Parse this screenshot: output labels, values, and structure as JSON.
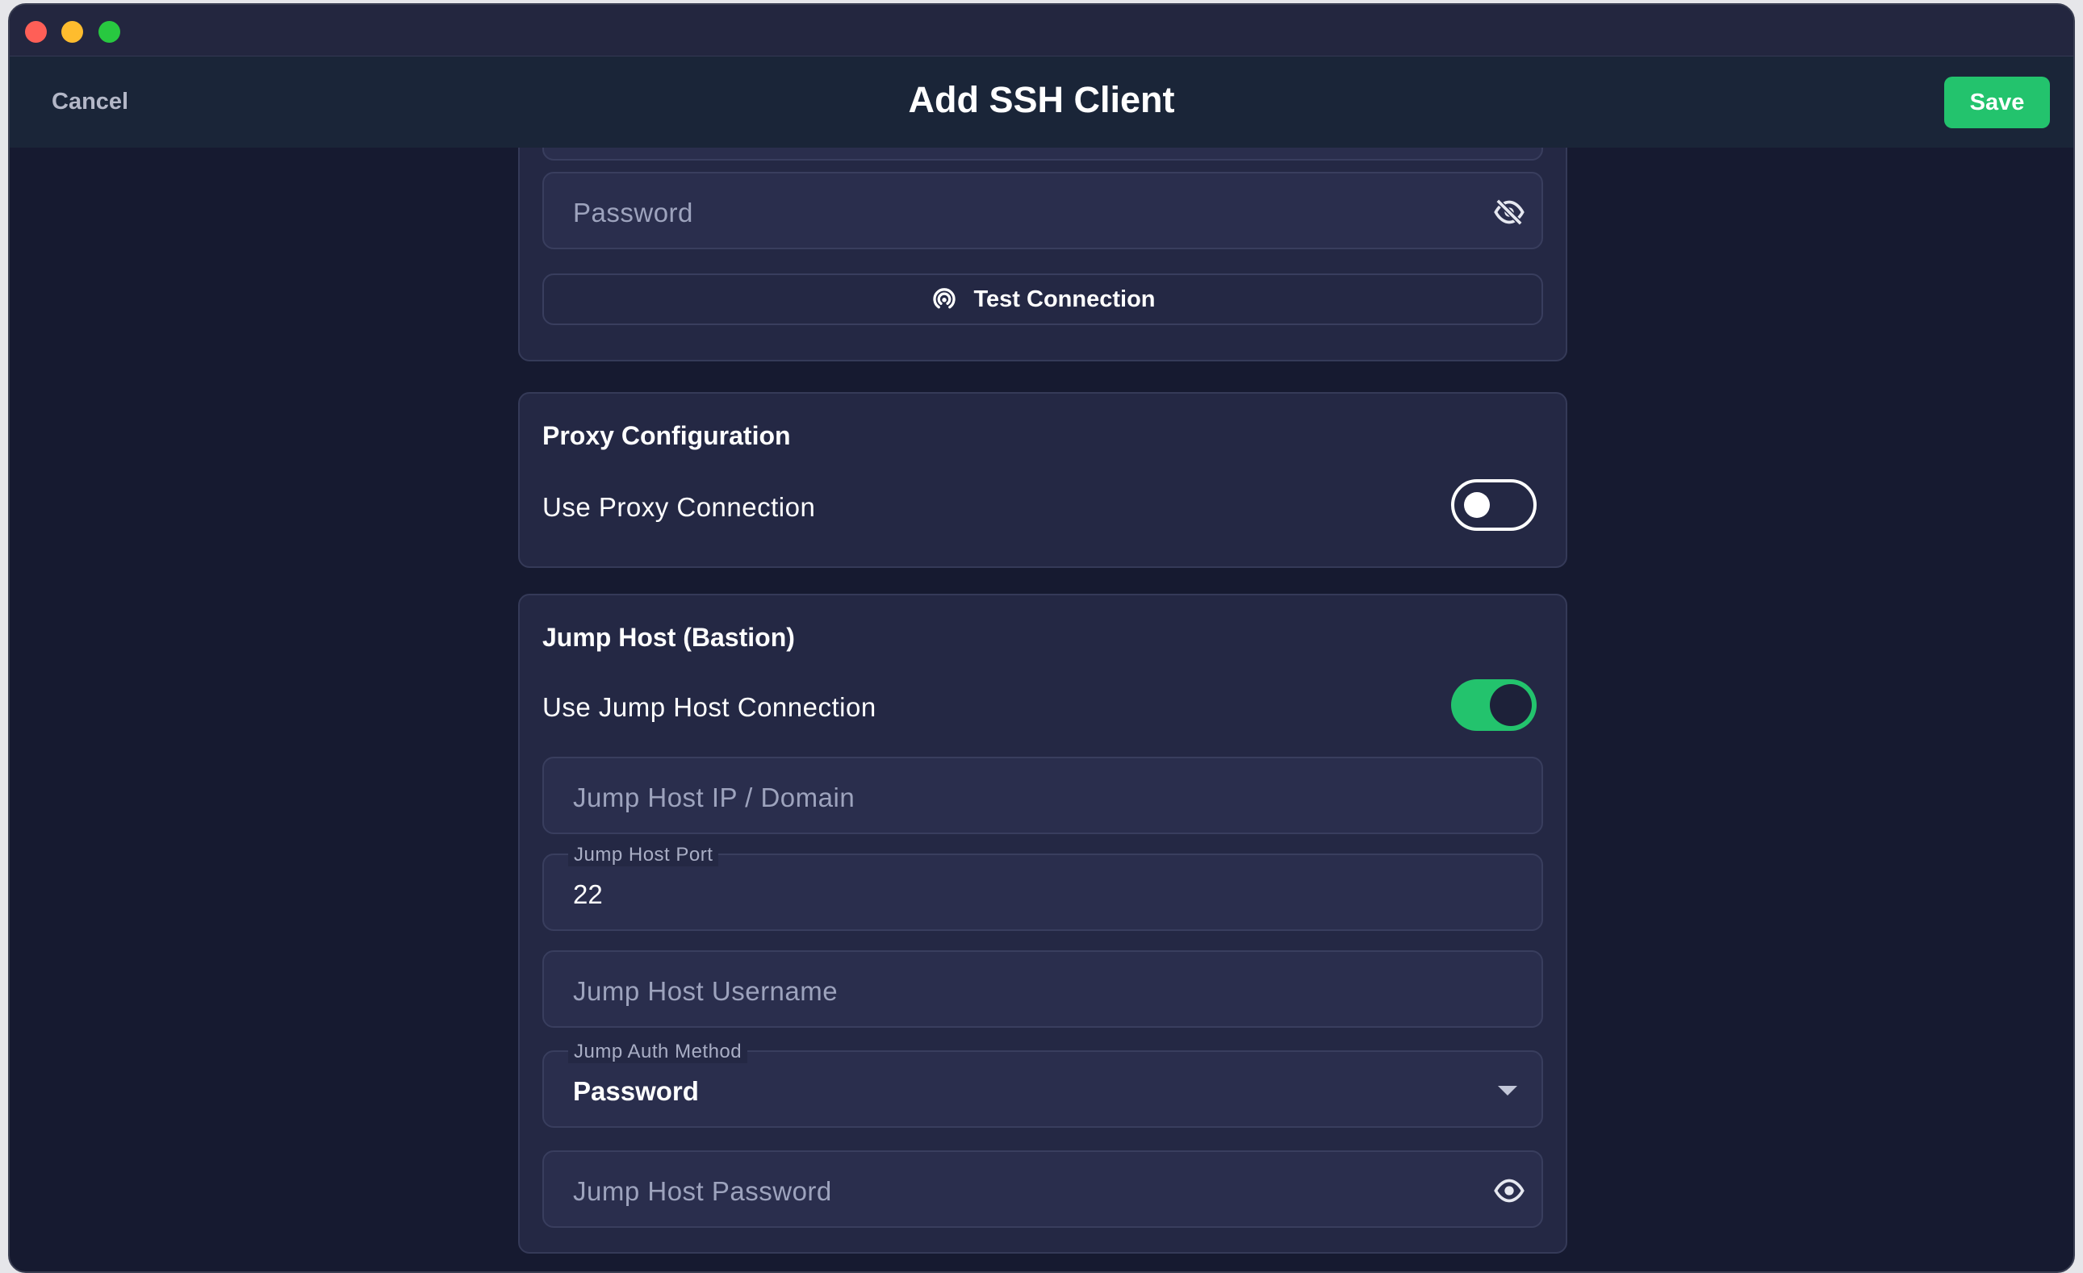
{
  "header": {
    "title": "Add SSH Client",
    "cancel_label": "Cancel",
    "save_label": "Save"
  },
  "auth_section": {
    "password_placeholder": "Password",
    "password_visibility_icon": "eye-off-icon",
    "test_connection_label": "Test Connection",
    "test_connection_icon": "signal-icon"
  },
  "proxy_section": {
    "title": "Proxy Configuration",
    "toggle_label": "Use Proxy Connection",
    "toggle_on": false
  },
  "jump_section": {
    "title": "Jump Host (Bastion)",
    "toggle_label": "Use Jump Host Connection",
    "toggle_on": true,
    "host_placeholder": "Jump Host IP / Domain",
    "port_label": "Jump Host Port",
    "port_value": "22",
    "username_placeholder": "Jump Host Username",
    "auth_method_label": "Jump Auth Method",
    "auth_method_value": "Password",
    "password_placeholder": "Jump Host Password",
    "password_visibility_icon": "eye-icon"
  },
  "colors": {
    "accent": "#23c36d",
    "background": "#161a30",
    "card": "#242844"
  }
}
